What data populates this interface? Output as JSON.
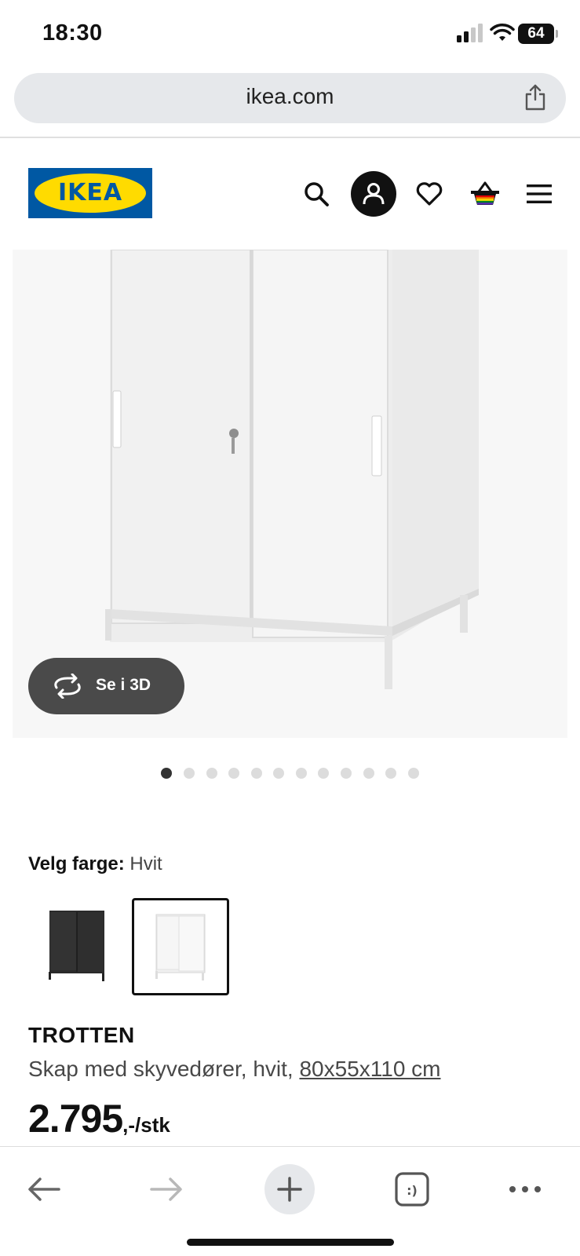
{
  "status_bar": {
    "time": "18:30",
    "battery": "64"
  },
  "browser": {
    "url": "ikea.com"
  },
  "brand": {
    "logo_text": "IKEA",
    "blue": "#0058a3",
    "yellow": "#ffdb00"
  },
  "header_icons": [
    "search-icon",
    "profile-icon",
    "heart-icon",
    "basket-icon",
    "menu-icon"
  ],
  "gallery": {
    "see_3d_label": "Se i 3D",
    "image_count": 12,
    "active_index": 0
  },
  "color": {
    "label": "Velg farge:",
    "selected": "Hvit",
    "options": [
      "black",
      "white"
    ]
  },
  "product": {
    "name": "TROTTEN",
    "description": "Skap med skyvedører, hvit,",
    "dimensions": "80x55x110 cm",
    "price": "2.795",
    "price_suffix": ",-/stk"
  },
  "toolbar_icons": [
    "back-arrow-icon",
    "forward-arrow-icon",
    "new-tab-icon",
    "tabs-icon",
    "more-icon"
  ]
}
